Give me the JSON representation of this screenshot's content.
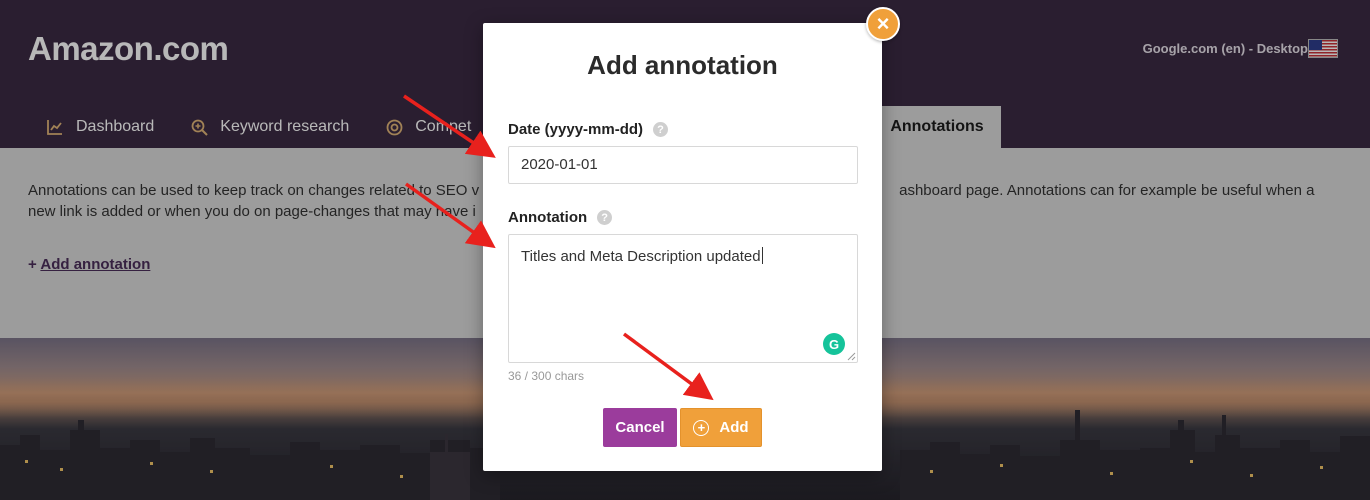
{
  "header": {
    "site_title": "Amazon.com",
    "search_engine": "Google.com (en) - Desktop",
    "flag_icon": "us-flag-icon"
  },
  "tabs": [
    {
      "label": "Dashboard",
      "icon": "chart-icon"
    },
    {
      "label": "Keyword research",
      "icon": "zoom-plus-icon"
    },
    {
      "label": "Compet",
      "icon": "target-icon"
    },
    {
      "label": "Annotations",
      "active": true
    }
  ],
  "content": {
    "description_line1_left": "Annotations can be used to keep track on changes related to SEO v",
    "description_line1_right": "ashboard page. Annotations can for example be useful when a",
    "description_line2_left": "new link is added or when you do on page-changes that may have i",
    "add_link_prefix": "+",
    "add_link_label": "Add annotation"
  },
  "modal": {
    "title": "Add annotation",
    "close_icon": "×",
    "date_label": "Date (yyyy-mm-dd)",
    "date_value": "2020-01-01",
    "annotation_label": "Annotation",
    "annotation_value": "Titles and Meta Description updated",
    "help_icon": "?",
    "grammarly_icon": "G",
    "char_count": "36 / 300 chars",
    "cancel_label": "Cancel",
    "add_label": "Add",
    "add_icon": "+"
  },
  "colors": {
    "header_bg": "#3b2a43",
    "cancel_bg": "#9b3c9c",
    "add_bg": "#f0a03a",
    "arrow": "#e8211d"
  }
}
